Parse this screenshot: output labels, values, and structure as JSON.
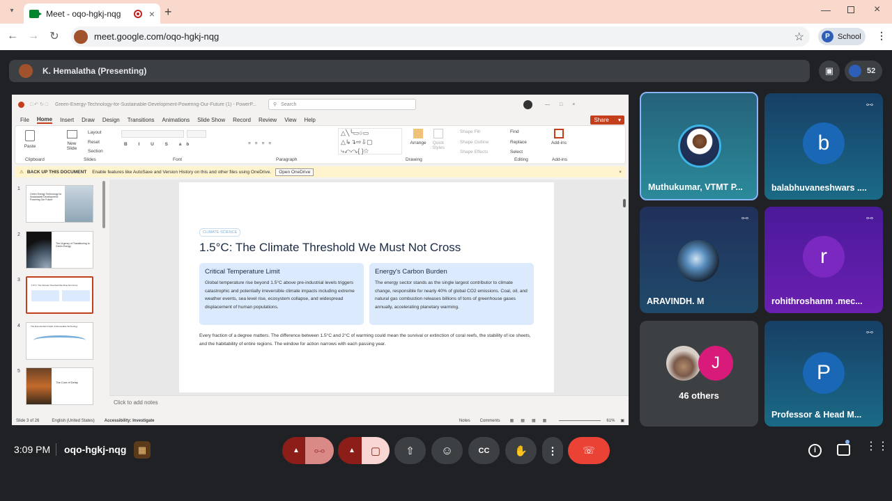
{
  "browser": {
    "tab_title": "Meet - oqo-hgkj-nqg",
    "url": "meet.google.com/oqo-hgkj-nqg",
    "profile_initial": "P",
    "profile_label": "School"
  },
  "meet": {
    "presenter_label": "K. Hemalatha (Presenting)",
    "participant_count": "52",
    "time": "3:09 PM",
    "meeting_code": "oqo-hgkj-nqg",
    "others_label": "46 others",
    "others_initial": "J"
  },
  "tiles": [
    {
      "name": "Muthukumar, VTMT P...",
      "initial": ""
    },
    {
      "name": "balabhuvaneshwars ....",
      "initial": "b"
    },
    {
      "name": "ARAVINDH. M",
      "initial": ""
    },
    {
      "name": "rohithroshanm .mec...",
      "initial": "r"
    },
    {
      "name": "Professor & Head M...",
      "initial": "P"
    }
  ],
  "ppt": {
    "file_title": "Green-Energy-Technology-for-Sustainable-Development-Powering-Our-Future (1) - PowerP...",
    "search": "Search",
    "share": "Share",
    "menu": [
      "File",
      "Home",
      "Insert",
      "Draw",
      "Design",
      "Transitions",
      "Animations",
      "Slide Show",
      "Record",
      "Review",
      "View",
      "Help"
    ],
    "ribbon": {
      "paste": "Paste",
      "clipboard": "Clipboard",
      "new_slide": "New Slide",
      "layout": "Layout",
      "reset": "Reset",
      "section": "Section",
      "slides": "Slides",
      "font": "Font",
      "paragraph": "Paragraph",
      "arrange": "Arrange",
      "quick_styles": "Quick Styles",
      "shape_fill": "Shape Fill",
      "shape_outline": "Shape Outline",
      "shape_effects": "Shape Effects",
      "drawing": "Drawing",
      "find": "Find",
      "replace": "Replace",
      "select": "Select",
      "editing": "Editing",
      "addins": "Add-ins",
      "addins_group": "Add-ins"
    },
    "notice_bold": "BACK UP THIS DOCUMENT",
    "notice_text": "Enable features like AutoSave and Version History on this and other files using OneDrive.",
    "notice_button": "Open OneDrive",
    "thumbs": [
      {
        "num": "1",
        "text": "Green Energy Technology for Sustainable Development: Powering Our Future"
      },
      {
        "num": "2",
        "text": "The Urgency of Transitioning to Green Energy"
      },
      {
        "num": "3",
        "text": "1.5°C: The Climate Threshold We Must Not Cross"
      },
      {
        "num": "4",
        "text": "The Exponential Growth of Renewable Technology"
      },
      {
        "num": "5",
        "text": "The Cost of Delay"
      }
    ],
    "slide": {
      "tag": "CLIMATE SCIENCE",
      "title": "1.5°C: The Climate Threshold We Must Not Cross",
      "card1_title": "Critical Temperature Limit",
      "card1_body": "Global temperature rise beyond 1.5°C above pre-industrial levels triggers catastrophic and potentially irreversible climate impacts including extreme weather events, sea level rise, ecosystem collapse, and widespread displacement of human populations.",
      "card2_title": "Energy's Carbon Burden",
      "card2_body": "The energy sector stands as the single largest contributor to climate change, responsible for nearly 40% of global CO2 emissions. Coal, oil, and natural gas combustion releases billions of tons of greenhouse gases annually, accelerating planetary warming.",
      "footer": "Every fraction of a degree matters. The difference between 1.5°C and 2°C of warming could mean the survival or extinction of coral reefs, the stability of ice sheets, and the habitability of entire regions. The window for action narrows with each passing year."
    },
    "notes_placeholder": "Click to add notes",
    "status": {
      "slide": "Slide 3 of 26",
      "lang": "English (United States)",
      "access": "Accessibility: Investigate",
      "notes": "Notes",
      "comments": "Comments",
      "zoom": "61%"
    }
  },
  "colors": {
    "end_call": "#ea4335",
    "mic_off_bg": "#8c1d18",
    "tile_bg": "#3c4043",
    "accent": "#8ab4f8"
  }
}
